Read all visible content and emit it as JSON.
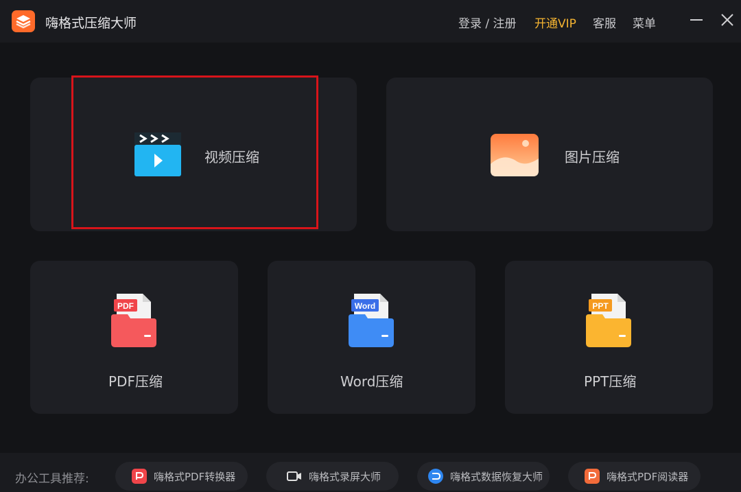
{
  "app": {
    "title": "嗨格式压缩大师"
  },
  "topbar": {
    "login_label": "登录 / 注册",
    "vip_label": "开通VIP",
    "service_label": "客服",
    "menu_label": "菜单"
  },
  "cards": {
    "video": {
      "label": "视频压缩"
    },
    "image": {
      "label": "图片压缩"
    },
    "pdf": {
      "label": "PDF压缩",
      "badge": "PDF"
    },
    "word": {
      "label": "Word压缩",
      "badge": "Word"
    },
    "ppt": {
      "label": "PPT压缩",
      "badge": "PPT"
    }
  },
  "bottom": {
    "recommend_label": "办公工具推荐:",
    "tools": [
      {
        "label": "嗨格式PDF转换器"
      },
      {
        "label": "嗨格式录屏大师"
      },
      {
        "label": "嗨格式数据恢复大师"
      },
      {
        "label": "嗨格式PDF阅读器"
      }
    ]
  },
  "colors": {
    "background": "#131417",
    "card": "#1e1f24",
    "vip": "#f5b431",
    "highlight": "#d8141a"
  }
}
